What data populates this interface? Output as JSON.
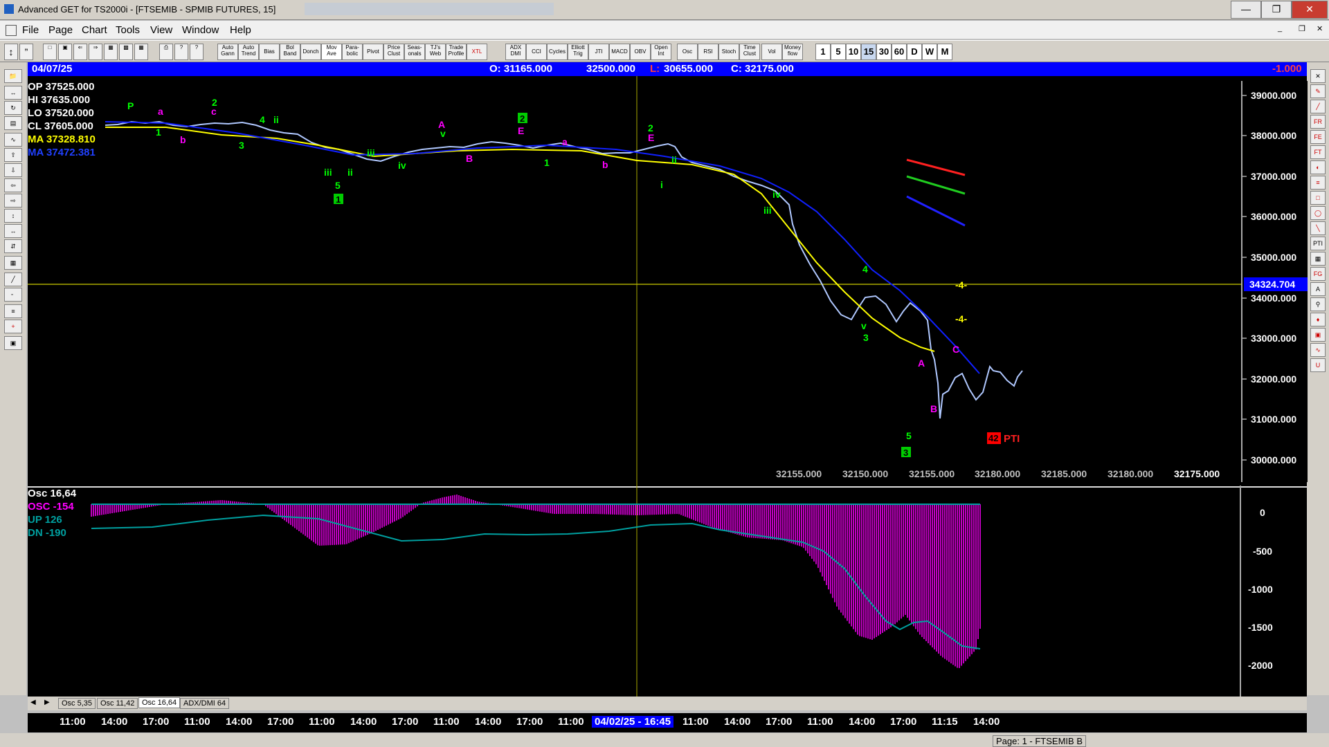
{
  "window": {
    "title": "Advanced GET for TS2000i - [FTSEMIB - SPMIB FUTURES, 15]",
    "buttons": [
      "—",
      "❐",
      "✕"
    ]
  },
  "menu": [
    "File",
    "Page",
    "Chart",
    "Tools",
    "View",
    "Window",
    "Help"
  ],
  "toolbar": {
    "studies": [
      "Auto Gann",
      "Auto Trend",
      "Bias",
      "Bol Band",
      "Donch",
      "Mov Ave",
      "Para-bolic",
      "Pivot",
      "Price Clust",
      "Seas-onals",
      "TJ's Web",
      "Trade Profile",
      "XTL",
      "ADX DMI",
      "CCI",
      "Cycles",
      "Elliott Trig",
      "JTI",
      "MACD",
      "OBV",
      "Open Int",
      "Osc",
      "RSI",
      "Stoch",
      "Time Clust",
      "Vol",
      "Money flow"
    ],
    "timeframes": [
      "1",
      "5",
      "10",
      "15",
      "30",
      "60",
      "D",
      "W",
      "M"
    ]
  },
  "infobar": {
    "date": "04/07/25",
    "open": "O: 31165.000",
    "high": "32500.000",
    "low_label": "L:",
    "low": "30655.000",
    "close": "C: 32175.000",
    "change": "-1.000"
  },
  "legend": {
    "op": "OP  37525.000",
    "hi": "HI   37635.000",
    "lo": "LO  37520.000",
    "cl": "CL  37605.000",
    "ma1": "MA  37328.810",
    "ma2": "MA  37472.381"
  },
  "price_axis": {
    "ticks": [
      "39000.000",
      "38000.000",
      "37000.000",
      "36000.000",
      "35000.000",
      "34000.000",
      "33000.000",
      "32000.000",
      "31000.000",
      "30000.000"
    ],
    "cursor_price": "34324.704"
  },
  "bottom_values": [
    "32155.000",
    "32150.000",
    "32155.000",
    "32180.000",
    "32185.000",
    "32180.000",
    "32175.000"
  ],
  "pti": {
    "value": "42",
    "label": "PTI"
  },
  "wave_labels": {
    "P": "P",
    "a": "a",
    "b": "b",
    "c": "c",
    "one": "1",
    "two": "2",
    "three": "3",
    "four": "4",
    "five": "5",
    "i": "i",
    "ii": "ii",
    "iii": "iii",
    "iv": "iv",
    "v": "v",
    "A": "A",
    "B": "B",
    "C": "C",
    "E": "E"
  },
  "targets": [
    "-4-",
    "-4-"
  ],
  "oscillator": {
    "title": "Osc 16,64",
    "osc": "OSC -154",
    "up": "UP   126",
    "dn": "DN   -190",
    "ticks": [
      "0",
      "-500",
      "-1000",
      "-1500",
      "-2000"
    ]
  },
  "tabs": [
    "Osc 5,35",
    "Osc 11,42",
    "Osc 16,64",
    "ADX/DMI 64"
  ],
  "active_tab": "Osc 16,64",
  "time_axis": [
    "11:00",
    "14:00",
    "17:00",
    "11:00",
    "14:00",
    "17:00",
    "11:00",
    "14:00",
    "17:00",
    "11:00",
    "14:00",
    "17:00",
    "11:00",
    "04/02/25 - 16:45",
    "11:00",
    "14:00",
    "17:00",
    "11:00",
    "14:00",
    "17:00",
    "11:15",
    "14:00"
  ],
  "status": "Page: 1 - FTSEMIB B",
  "colors": {
    "accent": "#0000ff",
    "wave_green": "#00ff00",
    "wave_magenta": "#ff00ff",
    "bars": "#b0c8ff",
    "ma_yellow": "#ffff00",
    "ma_blue": "#0000ff",
    "osc_magenta": "#ff00ff",
    "osc_teal": "#00a0a0"
  }
}
